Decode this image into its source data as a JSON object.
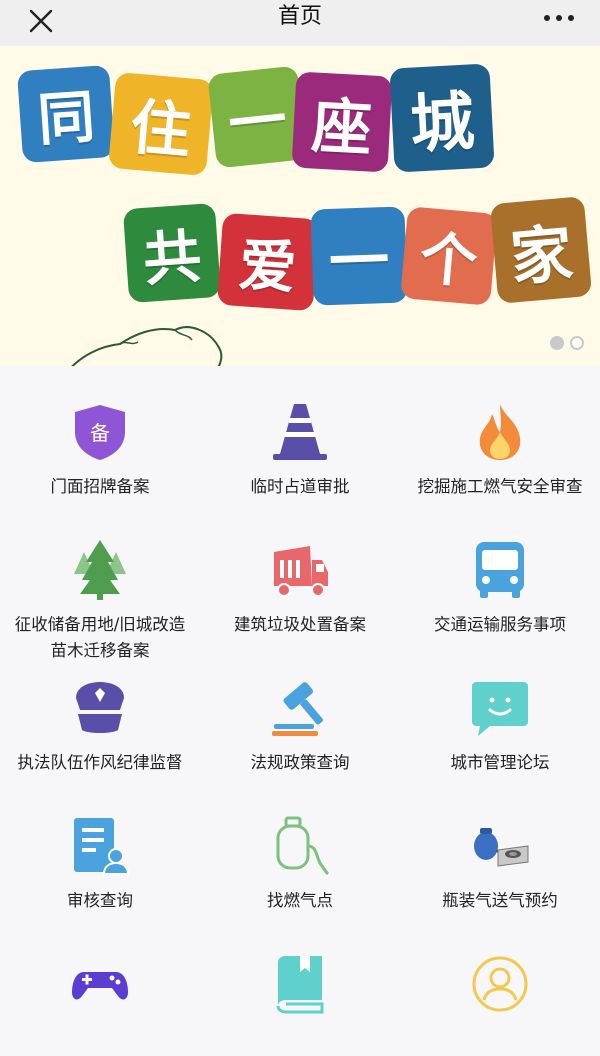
{
  "nav": {
    "title": "首页",
    "close_icon": "close-icon",
    "more_icon": "more-dots-icon"
  },
  "banner": {
    "line1": [
      "同",
      "住",
      "一",
      "座",
      "城"
    ],
    "line2": [
      "共",
      "爱",
      "一",
      "个",
      "家"
    ],
    "line1_colors": [
      "#2f7fc1",
      "#f0b429",
      "#7cb342",
      "#9c2a7c",
      "#1f5f8b"
    ],
    "line2_colors": [
      "#2e8b3e",
      "#d3323a",
      "#2f7fc1",
      "#e26d4e",
      "#a8702a"
    ],
    "slide_count": 2,
    "active_slide": 1
  },
  "services": [
    {
      "label": "门面招牌备案",
      "icon": "record-shield-icon",
      "icon_text": "备"
    },
    {
      "label": "临时占道审批",
      "icon": "traffic-cone-icon"
    },
    {
      "label": "挖掘施工燃气安全审查",
      "icon": "flame-icon"
    },
    {
      "label": "征收储备用地/旧城改造苗木迁移备案",
      "icon": "tree-icon"
    },
    {
      "label": "建筑垃圾处置备案",
      "icon": "garbage-truck-icon"
    },
    {
      "label": "交通运输服务事项",
      "icon": "bus-icon"
    },
    {
      "label": "执法队伍作风纪律监督",
      "icon": "police-cap-icon"
    },
    {
      "label": "法规政策查询",
      "icon": "gavel-icon"
    },
    {
      "label": "城市管理论坛",
      "icon": "chat-bubble-icon"
    },
    {
      "label": "审核查询",
      "icon": "document-user-icon"
    },
    {
      "label": "找燃气点",
      "icon": "gas-cylinder-icon"
    },
    {
      "label": "瓶装气送气预约",
      "icon": "gas-stove-icon"
    },
    {
      "label": "",
      "icon": "gamepad-icon"
    },
    {
      "label": "",
      "icon": "book-icon"
    },
    {
      "label": "",
      "icon": "user-circle-icon"
    }
  ]
}
